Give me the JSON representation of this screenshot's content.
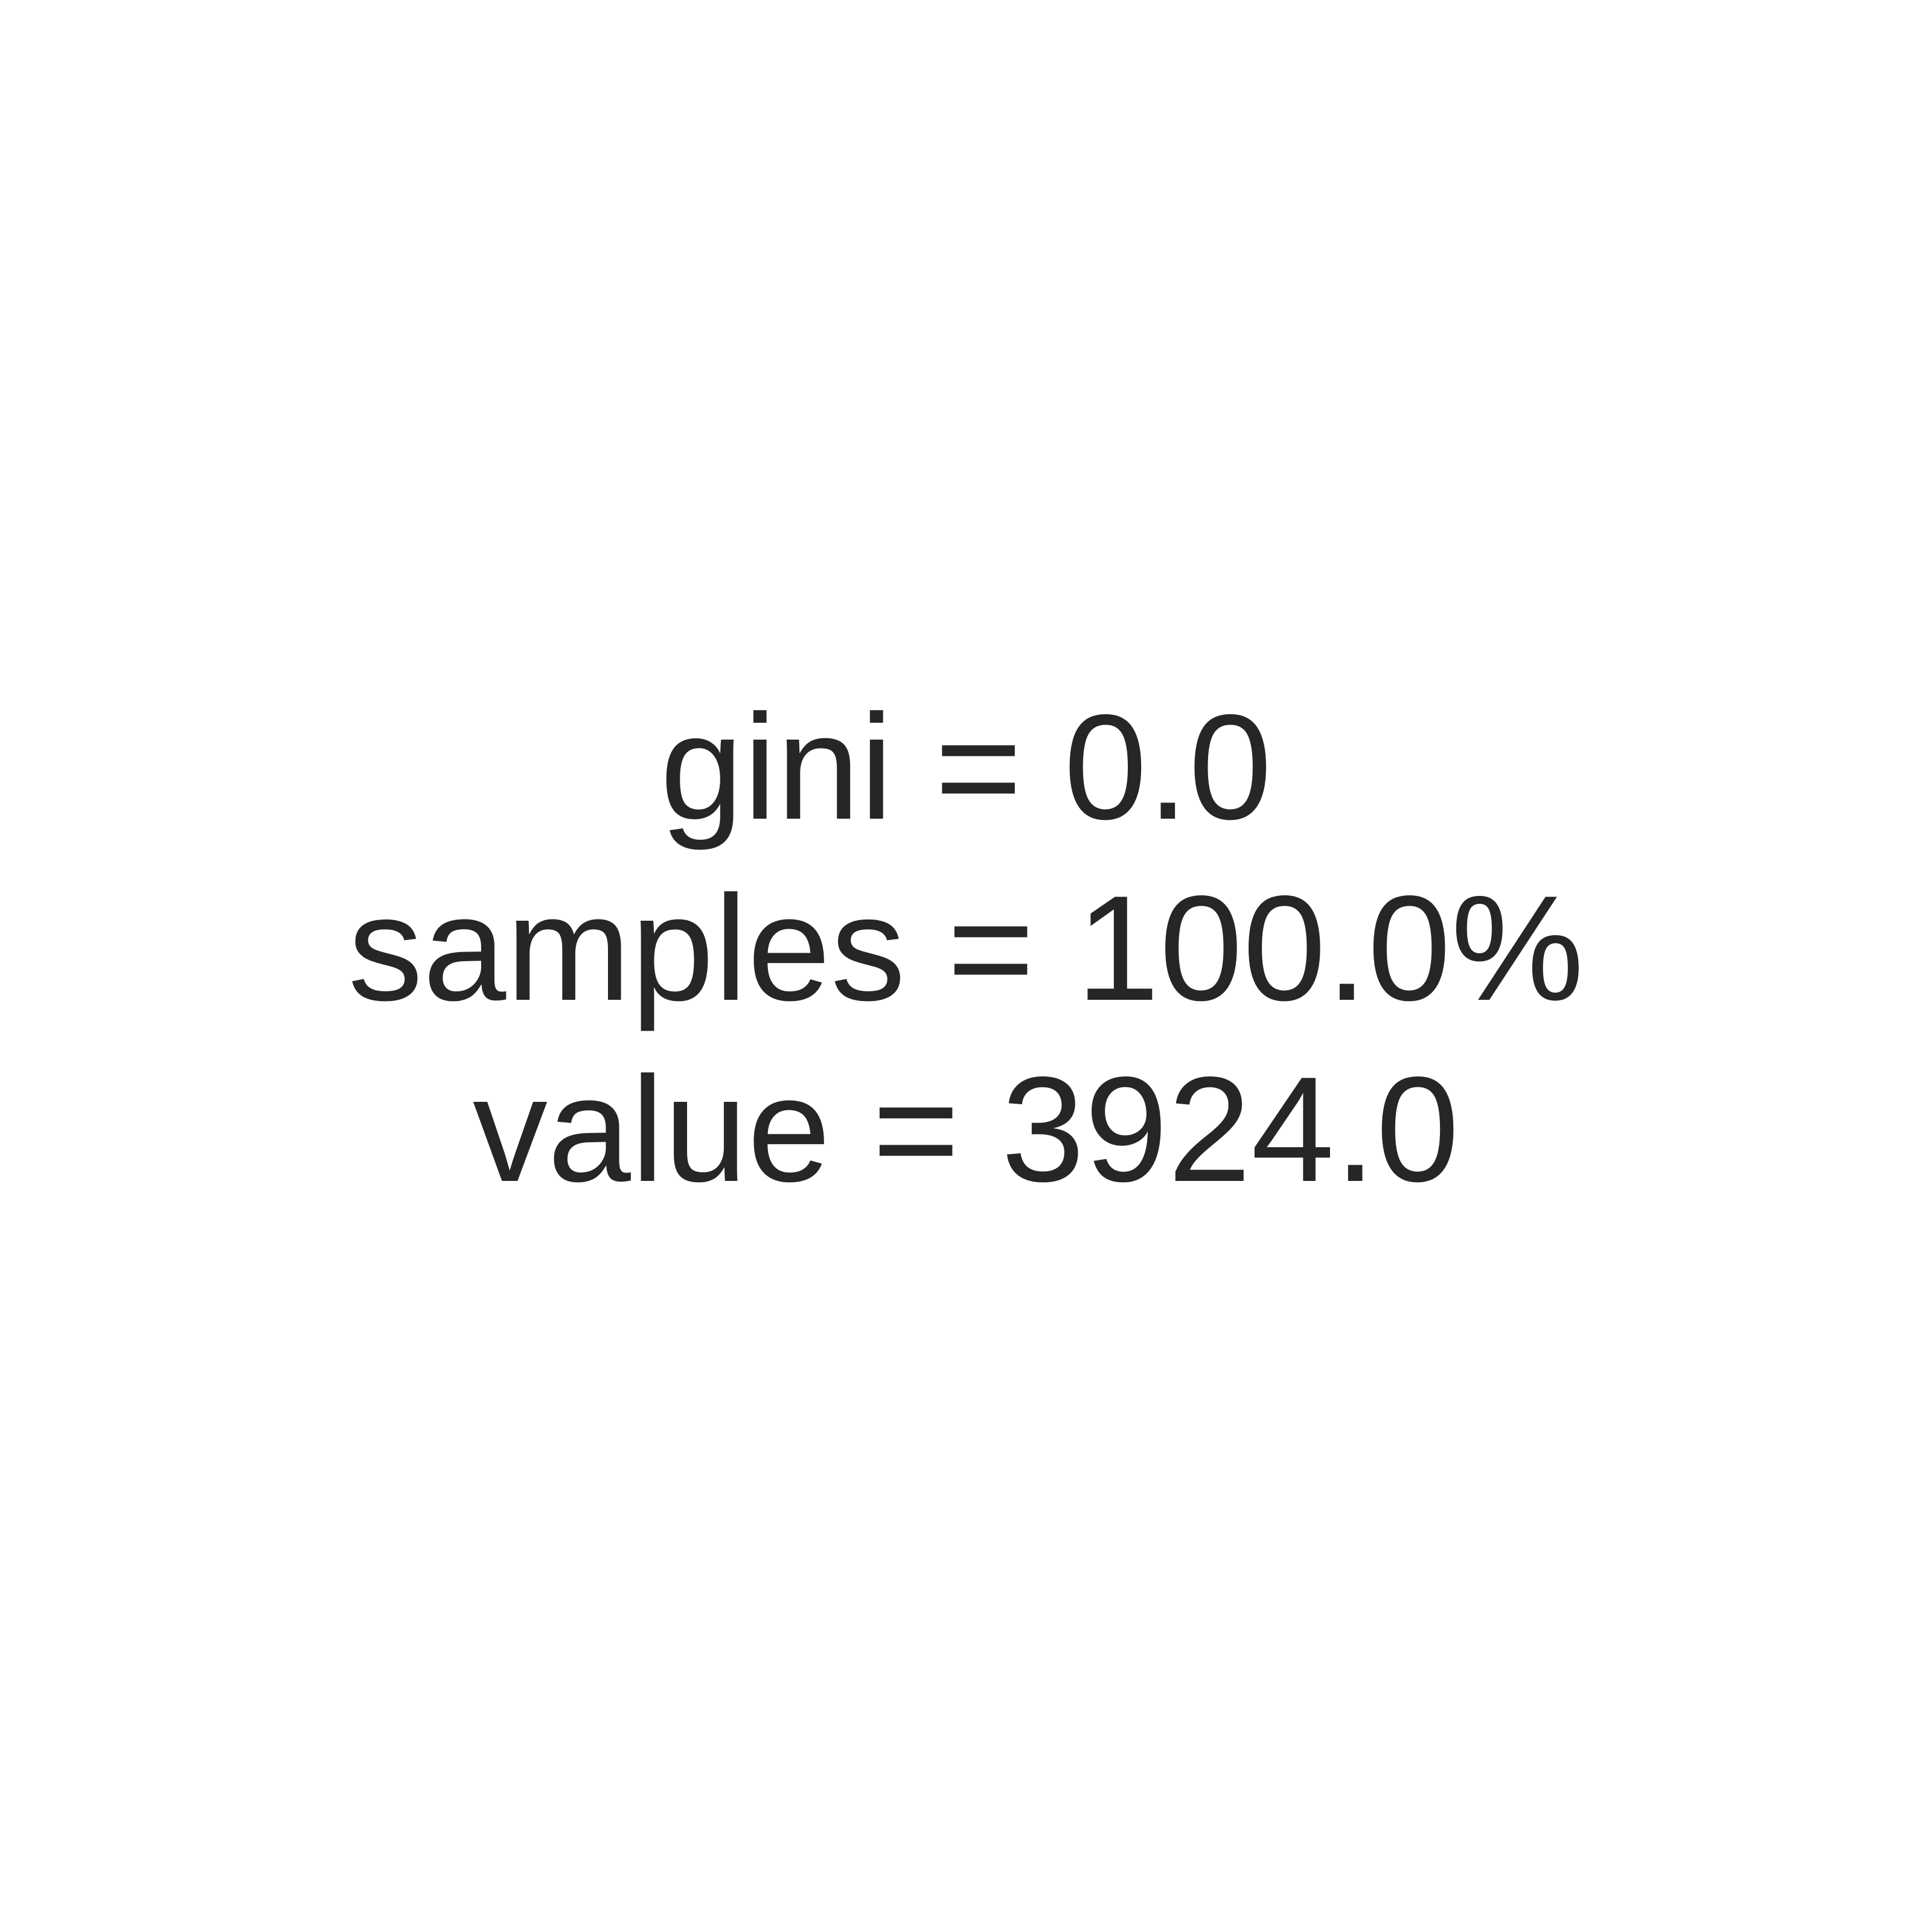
{
  "node": {
    "lines": [
      "gini = 0.0",
      "samples = 100.0%",
      "value = 3924.0"
    ],
    "text_color": "#262626",
    "background_color": "#ffffff"
  }
}
